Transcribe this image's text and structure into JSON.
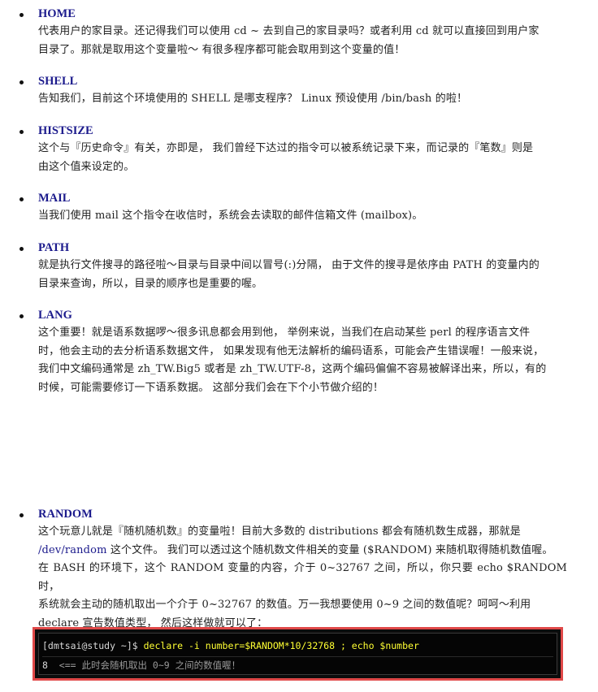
{
  "entries": [
    {
      "term": "HOME",
      "lines": [
        "代表用户的家目录。还记得我们可以使用 cd ~ 去到自己的家目录吗？或者利用 cd 就可以直接回到用户家",
        "目录了。那就是取用这个变量啦～ 有很多程序都可能会取用到这个变量的值！"
      ]
    },
    {
      "term": "SHELL",
      "lines": [
        "告知我们，目前这个环境使用的 SHELL 是哪支程序？ Linux 预设使用 /bin/bash 的啦！"
      ]
    },
    {
      "term": "HISTSIZE",
      "lines": [
        "这个与『历史命令』有关，亦即是， 我们曾经下达过的指令可以被系统记录下来，而记录的『笔数』则是",
        "由这个值来设定的。"
      ]
    },
    {
      "term": "MAIL",
      "lines": [
        "当我们使用 mail 这个指令在收信时，系统会去读取的邮件信箱文件 (mailbox)。"
      ]
    },
    {
      "term": "PATH",
      "lines": [
        "就是执行文件搜寻的路径啦～目录与目录中间以冒号(:)分隔， 由于文件的搜寻是依序由 PATH 的变量内的",
        "目录来查询，所以，目录的顺序也是重要的喔。"
      ]
    },
    {
      "term": "LANG",
      "lines": [
        "这个重要！就是语系数据啰～很多讯息都会用到他， 举例来说，当我们在启动某些 perl 的程序语言文件",
        "时，他会主动的去分析语系数据文件， 如果发现有他无法解析的编码语系，可能会产生错误喔！一般来说，",
        "我们中文编码通常是 zh_TW.Big5 或者是 zh_TW.UTF-8，这两个编码偏偏不容易被解译出来，所以，有的",
        "时候，可能需要修订一下语系数据。 这部分我们会在下个小节做介绍的！"
      ]
    }
  ],
  "random": {
    "term": "RANDOM",
    "line1": "这个玩意儿就是『随机随机数』的变量啦！目前大多数的 distributions 都会有随机数生成器，那就是",
    "link": "/dev/random",
    "line2_rest": " 这个文件。 我们可以透过这个随机数文件相关的变量 ($RANDOM) 来随机取得随机数值喔。",
    "line3": "在 BASH 的环境下，这个 RANDOM 变量的内容，介于 0~32767 之间，所以，你只要 echo $RANDOM 时，",
    "line4": "系统就会主动的随机取出一个介于 0~32767 的数值。万一我想要使用 0~9 之间的数值呢？呵呵～利用",
    "line5": "declare 宣告数值类型， 然后这样做就可以了："
  },
  "terminal": {
    "prompt": "[dmtsai@study ~]$ ",
    "command": "declare -i number=$RANDOM*10/32768 ; echo $number",
    "output_value": "8",
    "output_comment": "  <== 此时会随机取出 0~9 之间的数值喔！"
  }
}
